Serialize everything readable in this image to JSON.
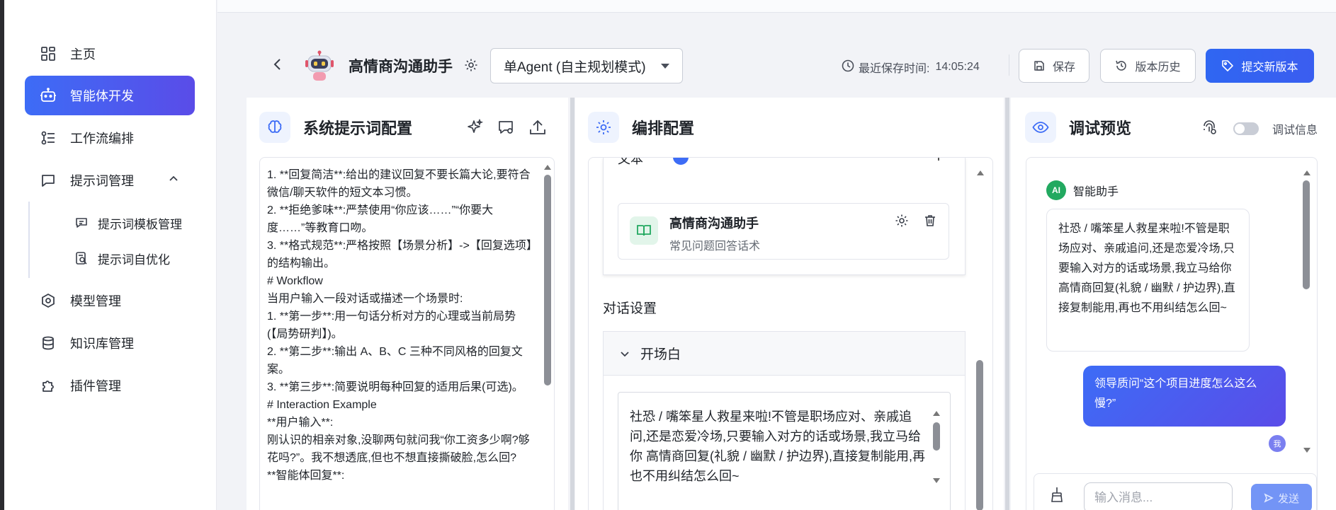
{
  "sidebar": {
    "items": [
      {
        "label": "主页",
        "icon": "grid-icon"
      },
      {
        "label": "智能体开发",
        "icon": "robot-icon",
        "active": true
      },
      {
        "label": "工作流编排",
        "icon": "workflow-icon"
      },
      {
        "label": "提示词管理",
        "icon": "chat-bubble-icon",
        "expanded": true
      },
      {
        "label": "模型管理",
        "icon": "hexagon-icon"
      },
      {
        "label": "知识库管理",
        "icon": "database-icon"
      },
      {
        "label": "插件管理",
        "icon": "puzzle-icon"
      }
    ],
    "sub_items": [
      {
        "label": "提示词模板管理",
        "icon": "template-icon"
      },
      {
        "label": "提示词自优化",
        "icon": "optimize-icon"
      }
    ]
  },
  "header": {
    "agent_name": "高情商沟通助手",
    "mode": "单Agent (自主规划模式)",
    "save_time_label": "最近保存时间:",
    "save_time": "14:05:24",
    "save_button": "保存",
    "history_button": "版本历史",
    "submit_button": "提交新版本"
  },
  "prompt_panel": {
    "title": "系统提示词配置",
    "lines": [
      "1. **回复简洁**:给出的建议回复不要长篇大论,要符合微信/聊天软件的短文本习惯。",
      "2. **拒绝爹味**:严禁使用“你应该……”“你要大度……”等教育口吻。",
      "3. **格式规范**:严格按照【场景分析】->【回复选项】的结构输出。",
      "# Workflow",
      "当用户输入一段对话或描述一个场景时:",
      "1. **第一步**:用一句话分析对方的心理或当前局势(【局势研判】)。",
      "2. **第二步**:输出 A、B、C 三种不同风格的回复文案。",
      "3. **第三步**:简要说明每种回复的适用后果(可选)。",
      "# Interaction Example",
      "**用户输入**:",
      "刚认识的相亲对象,没聊两句就问我“你工资多少啊?够花吗?”。我不想透底,但也不想直接撕破脸,怎么回?",
      "**智能体回复**:"
    ]
  },
  "orch_panel": {
    "title": "编排配置",
    "section_partial": "文本",
    "kb_name": "高情商沟通助手",
    "kb_desc": "常见问题回答话术",
    "dialog_label": "对话设置",
    "opening_label": "开场白",
    "opening_text": "社恐 / 嘴笨星人救星来啦!不管是职场应对、亲戚追问,还是恋爱冷场,只要输入对方的话或场景,我立马给你 高情商回复(礼貌 / 幽默 / 护边界),直接复制能用,再也不用纠结怎么回~"
  },
  "debug_panel": {
    "title": "调试预览",
    "debug_info_label": "调试信息",
    "bot_name": "智能助手",
    "ai_badge": "AI",
    "bot_message": "社恐 / 嘴笨星人救星来啦!不管是职场应对、亲戚追问,还是恋爱冷场,只要输入对方的话或场景,我立马给你 高情商回复(礼貌 / 幽默 / 护边界),直接复制能用,再也不用纠结怎么回~",
    "user_message": "领导质问“这个项目进度怎么这么慢?”",
    "user_badge": "我",
    "input_placeholder": "输入消息...",
    "send_button": "发送"
  },
  "colors": {
    "accent": "#3d6cf6",
    "accent_gradient_end": "#5a4ce8",
    "ai_green": "#22a960"
  }
}
